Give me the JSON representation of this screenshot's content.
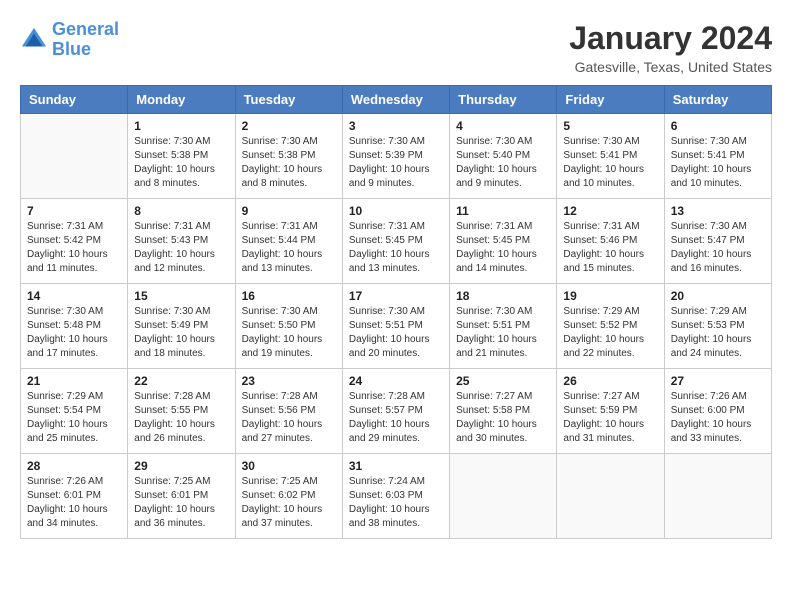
{
  "header": {
    "logo_line1": "General",
    "logo_line2": "Blue",
    "month": "January 2024",
    "location": "Gatesville, Texas, United States"
  },
  "days_of_week": [
    "Sunday",
    "Monday",
    "Tuesday",
    "Wednesday",
    "Thursday",
    "Friday",
    "Saturday"
  ],
  "weeks": [
    [
      {
        "day": "",
        "info": ""
      },
      {
        "day": "1",
        "info": "Sunrise: 7:30 AM\nSunset: 5:38 PM\nDaylight: 10 hours\nand 8 minutes."
      },
      {
        "day": "2",
        "info": "Sunrise: 7:30 AM\nSunset: 5:38 PM\nDaylight: 10 hours\nand 8 minutes."
      },
      {
        "day": "3",
        "info": "Sunrise: 7:30 AM\nSunset: 5:39 PM\nDaylight: 10 hours\nand 9 minutes."
      },
      {
        "day": "4",
        "info": "Sunrise: 7:30 AM\nSunset: 5:40 PM\nDaylight: 10 hours\nand 9 minutes."
      },
      {
        "day": "5",
        "info": "Sunrise: 7:30 AM\nSunset: 5:41 PM\nDaylight: 10 hours\nand 10 minutes."
      },
      {
        "day": "6",
        "info": "Sunrise: 7:30 AM\nSunset: 5:41 PM\nDaylight: 10 hours\nand 10 minutes."
      }
    ],
    [
      {
        "day": "7",
        "info": "Sunrise: 7:31 AM\nSunset: 5:42 PM\nDaylight: 10 hours\nand 11 minutes."
      },
      {
        "day": "8",
        "info": "Sunrise: 7:31 AM\nSunset: 5:43 PM\nDaylight: 10 hours\nand 12 minutes."
      },
      {
        "day": "9",
        "info": "Sunrise: 7:31 AM\nSunset: 5:44 PM\nDaylight: 10 hours\nand 13 minutes."
      },
      {
        "day": "10",
        "info": "Sunrise: 7:31 AM\nSunset: 5:45 PM\nDaylight: 10 hours\nand 13 minutes."
      },
      {
        "day": "11",
        "info": "Sunrise: 7:31 AM\nSunset: 5:45 PM\nDaylight: 10 hours\nand 14 minutes."
      },
      {
        "day": "12",
        "info": "Sunrise: 7:31 AM\nSunset: 5:46 PM\nDaylight: 10 hours\nand 15 minutes."
      },
      {
        "day": "13",
        "info": "Sunrise: 7:30 AM\nSunset: 5:47 PM\nDaylight: 10 hours\nand 16 minutes."
      }
    ],
    [
      {
        "day": "14",
        "info": "Sunrise: 7:30 AM\nSunset: 5:48 PM\nDaylight: 10 hours\nand 17 minutes."
      },
      {
        "day": "15",
        "info": "Sunrise: 7:30 AM\nSunset: 5:49 PM\nDaylight: 10 hours\nand 18 minutes."
      },
      {
        "day": "16",
        "info": "Sunrise: 7:30 AM\nSunset: 5:50 PM\nDaylight: 10 hours\nand 19 minutes."
      },
      {
        "day": "17",
        "info": "Sunrise: 7:30 AM\nSunset: 5:51 PM\nDaylight: 10 hours\nand 20 minutes."
      },
      {
        "day": "18",
        "info": "Sunrise: 7:30 AM\nSunset: 5:51 PM\nDaylight: 10 hours\nand 21 minutes."
      },
      {
        "day": "19",
        "info": "Sunrise: 7:29 AM\nSunset: 5:52 PM\nDaylight: 10 hours\nand 22 minutes."
      },
      {
        "day": "20",
        "info": "Sunrise: 7:29 AM\nSunset: 5:53 PM\nDaylight: 10 hours\nand 24 minutes."
      }
    ],
    [
      {
        "day": "21",
        "info": "Sunrise: 7:29 AM\nSunset: 5:54 PM\nDaylight: 10 hours\nand 25 minutes."
      },
      {
        "day": "22",
        "info": "Sunrise: 7:28 AM\nSunset: 5:55 PM\nDaylight: 10 hours\nand 26 minutes."
      },
      {
        "day": "23",
        "info": "Sunrise: 7:28 AM\nSunset: 5:56 PM\nDaylight: 10 hours\nand 27 minutes."
      },
      {
        "day": "24",
        "info": "Sunrise: 7:28 AM\nSunset: 5:57 PM\nDaylight: 10 hours\nand 29 minutes."
      },
      {
        "day": "25",
        "info": "Sunrise: 7:27 AM\nSunset: 5:58 PM\nDaylight: 10 hours\nand 30 minutes."
      },
      {
        "day": "26",
        "info": "Sunrise: 7:27 AM\nSunset: 5:59 PM\nDaylight: 10 hours\nand 31 minutes."
      },
      {
        "day": "27",
        "info": "Sunrise: 7:26 AM\nSunset: 6:00 PM\nDaylight: 10 hours\nand 33 minutes."
      }
    ],
    [
      {
        "day": "28",
        "info": "Sunrise: 7:26 AM\nSunset: 6:01 PM\nDaylight: 10 hours\nand 34 minutes."
      },
      {
        "day": "29",
        "info": "Sunrise: 7:25 AM\nSunset: 6:01 PM\nDaylight: 10 hours\nand 36 minutes."
      },
      {
        "day": "30",
        "info": "Sunrise: 7:25 AM\nSunset: 6:02 PM\nDaylight: 10 hours\nand 37 minutes."
      },
      {
        "day": "31",
        "info": "Sunrise: 7:24 AM\nSunset: 6:03 PM\nDaylight: 10 hours\nand 38 minutes."
      },
      {
        "day": "",
        "info": ""
      },
      {
        "day": "",
        "info": ""
      },
      {
        "day": "",
        "info": ""
      }
    ]
  ]
}
